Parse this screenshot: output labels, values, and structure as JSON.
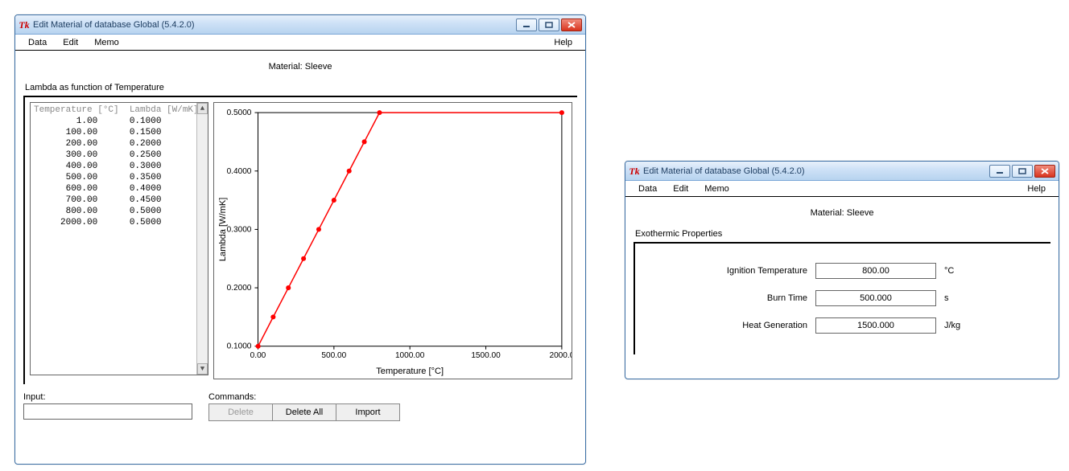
{
  "app_icon_glyph": "Tk",
  "window_title": "Edit Material of database Global (5.4.2.0)",
  "menu": {
    "data": "Data",
    "edit": "Edit",
    "memo": "Memo",
    "help": "Help"
  },
  "material_header": "Material: Sleeve",
  "left": {
    "page_title": "Lambda as function of Temperature",
    "table_header": "Temperature [°C]  Lambda [W/mK]",
    "rows": [
      {
        "t": "1.00",
        "l": "0.1000"
      },
      {
        "t": "100.00",
        "l": "0.1500"
      },
      {
        "t": "200.00",
        "l": "0.2000"
      },
      {
        "t": "300.00",
        "l": "0.2500"
      },
      {
        "t": "400.00",
        "l": "0.3000"
      },
      {
        "t": "500.00",
        "l": "0.3500"
      },
      {
        "t": "600.00",
        "l": "0.4000"
      },
      {
        "t": "700.00",
        "l": "0.4500"
      },
      {
        "t": "800.00",
        "l": "0.5000"
      },
      {
        "t": "2000.00",
        "l": "0.5000"
      }
    ],
    "input_label": "Input:",
    "commands_label": "Commands:",
    "buttons": {
      "delete": "Delete",
      "delete_all": "Delete All",
      "import": "Import"
    }
  },
  "right": {
    "page_title": "Exothermic Properties",
    "fields": {
      "ignition_temp": {
        "label": "Ignition Temperature",
        "value": "800.00",
        "unit": "°C"
      },
      "burn_time": {
        "label": "Burn Time",
        "value": "500.000",
        "unit": "s"
      },
      "heat_gen": {
        "label": "Heat Generation",
        "value": "1500.000",
        "unit": "J/kg"
      }
    }
  },
  "chart_data": {
    "type": "line",
    "title": "",
    "xlabel": "Temperature [°C]",
    "ylabel": "Lambda [W/mK]",
    "xlim": [
      0,
      2000
    ],
    "ylim": [
      0.1,
      0.5
    ],
    "xticks": [
      0.0,
      500.0,
      1000.0,
      1500.0,
      2000.0
    ],
    "yticks": [
      0.1,
      0.2,
      0.3,
      0.4,
      0.5
    ],
    "series": [
      {
        "name": "Lambda",
        "color": "#ff0000",
        "x": [
          1,
          100,
          200,
          300,
          400,
          500,
          600,
          700,
          800,
          2000
        ],
        "y": [
          0.1,
          0.15,
          0.2,
          0.25,
          0.3,
          0.35,
          0.4,
          0.45,
          0.5,
          0.5
        ]
      }
    ]
  }
}
